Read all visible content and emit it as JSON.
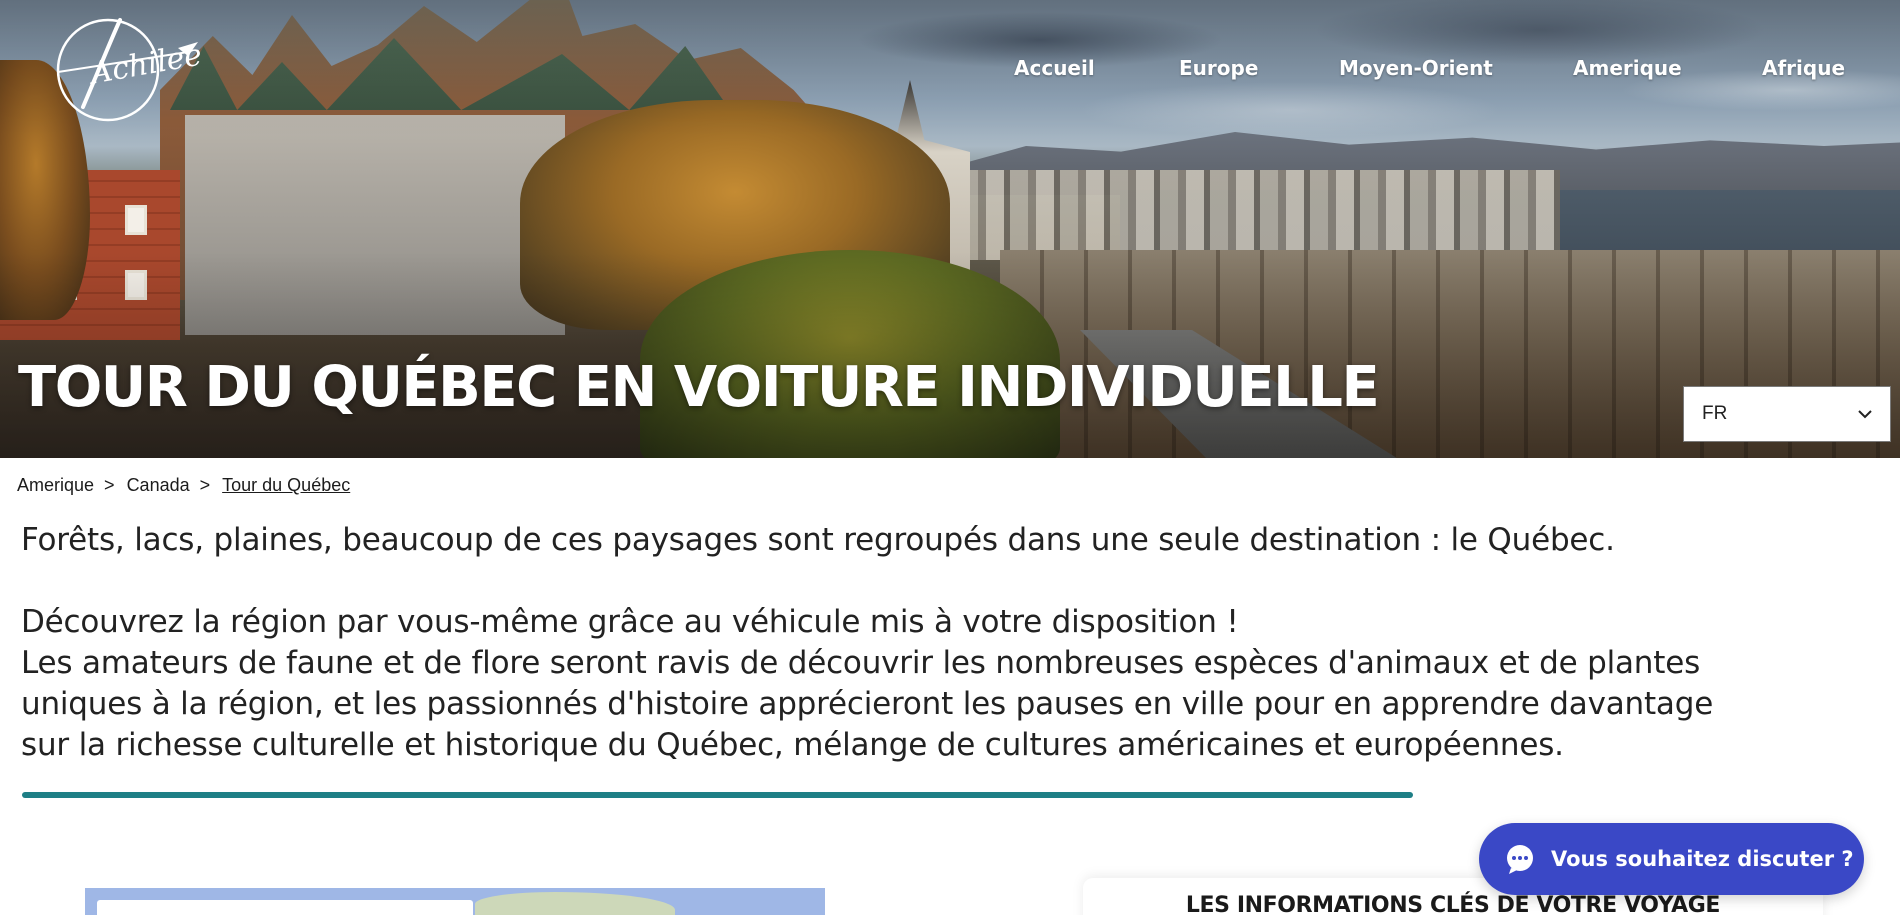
{
  "brand": {
    "logo_text": "Achilee"
  },
  "nav": {
    "items": [
      {
        "label": "Accueil"
      },
      {
        "label": "Europe"
      },
      {
        "label": "Moyen-Orient"
      },
      {
        "label": "Amerique"
      },
      {
        "label": "Afrique"
      }
    ]
  },
  "hero": {
    "title": "TOUR DU QUÉBEC EN VOITURE INDIVIDUELLE"
  },
  "language": {
    "selected": "FR"
  },
  "breadcrumb": {
    "items": [
      {
        "label": "Amerique"
      },
      {
        "label": "Canada"
      },
      {
        "label": "Tour du Québec"
      }
    ],
    "separator": ">"
  },
  "intro": {
    "line1": "Forêts, lacs, plaines, beaucoup de ces paysages sont regroupés dans une seule destination : le Québec.",
    "line2": "Découvrez la région par vous-même grâce au véhicule mis à votre disposition !",
    "line3": "Les amateurs de faune et de flore seront ravis de découvrir les nombreuses espèces d'animaux et de plantes",
    "line4": "uniques à la région, et les passionnés d'histoire apprécieront les pauses en ville pour en apprendre davantage",
    "line5": "sur la richesse culturelle et historique du Québec, mélange de cultures américaines et européennes."
  },
  "info_card": {
    "title": "LES INFORMATIONS CLÉS DE VOTRE VOYAGE"
  },
  "chat": {
    "label": "Vous souhaitez discuter ?"
  },
  "colors": {
    "accent_teal": "#1e7f86",
    "chat_blue": "#3a48c6",
    "map_water": "#9fb7e6"
  },
  "icons": {
    "logo": "achilee-logo-icon",
    "chevron": "chevron-down-icon",
    "chat": "chat-bubble-icon"
  }
}
